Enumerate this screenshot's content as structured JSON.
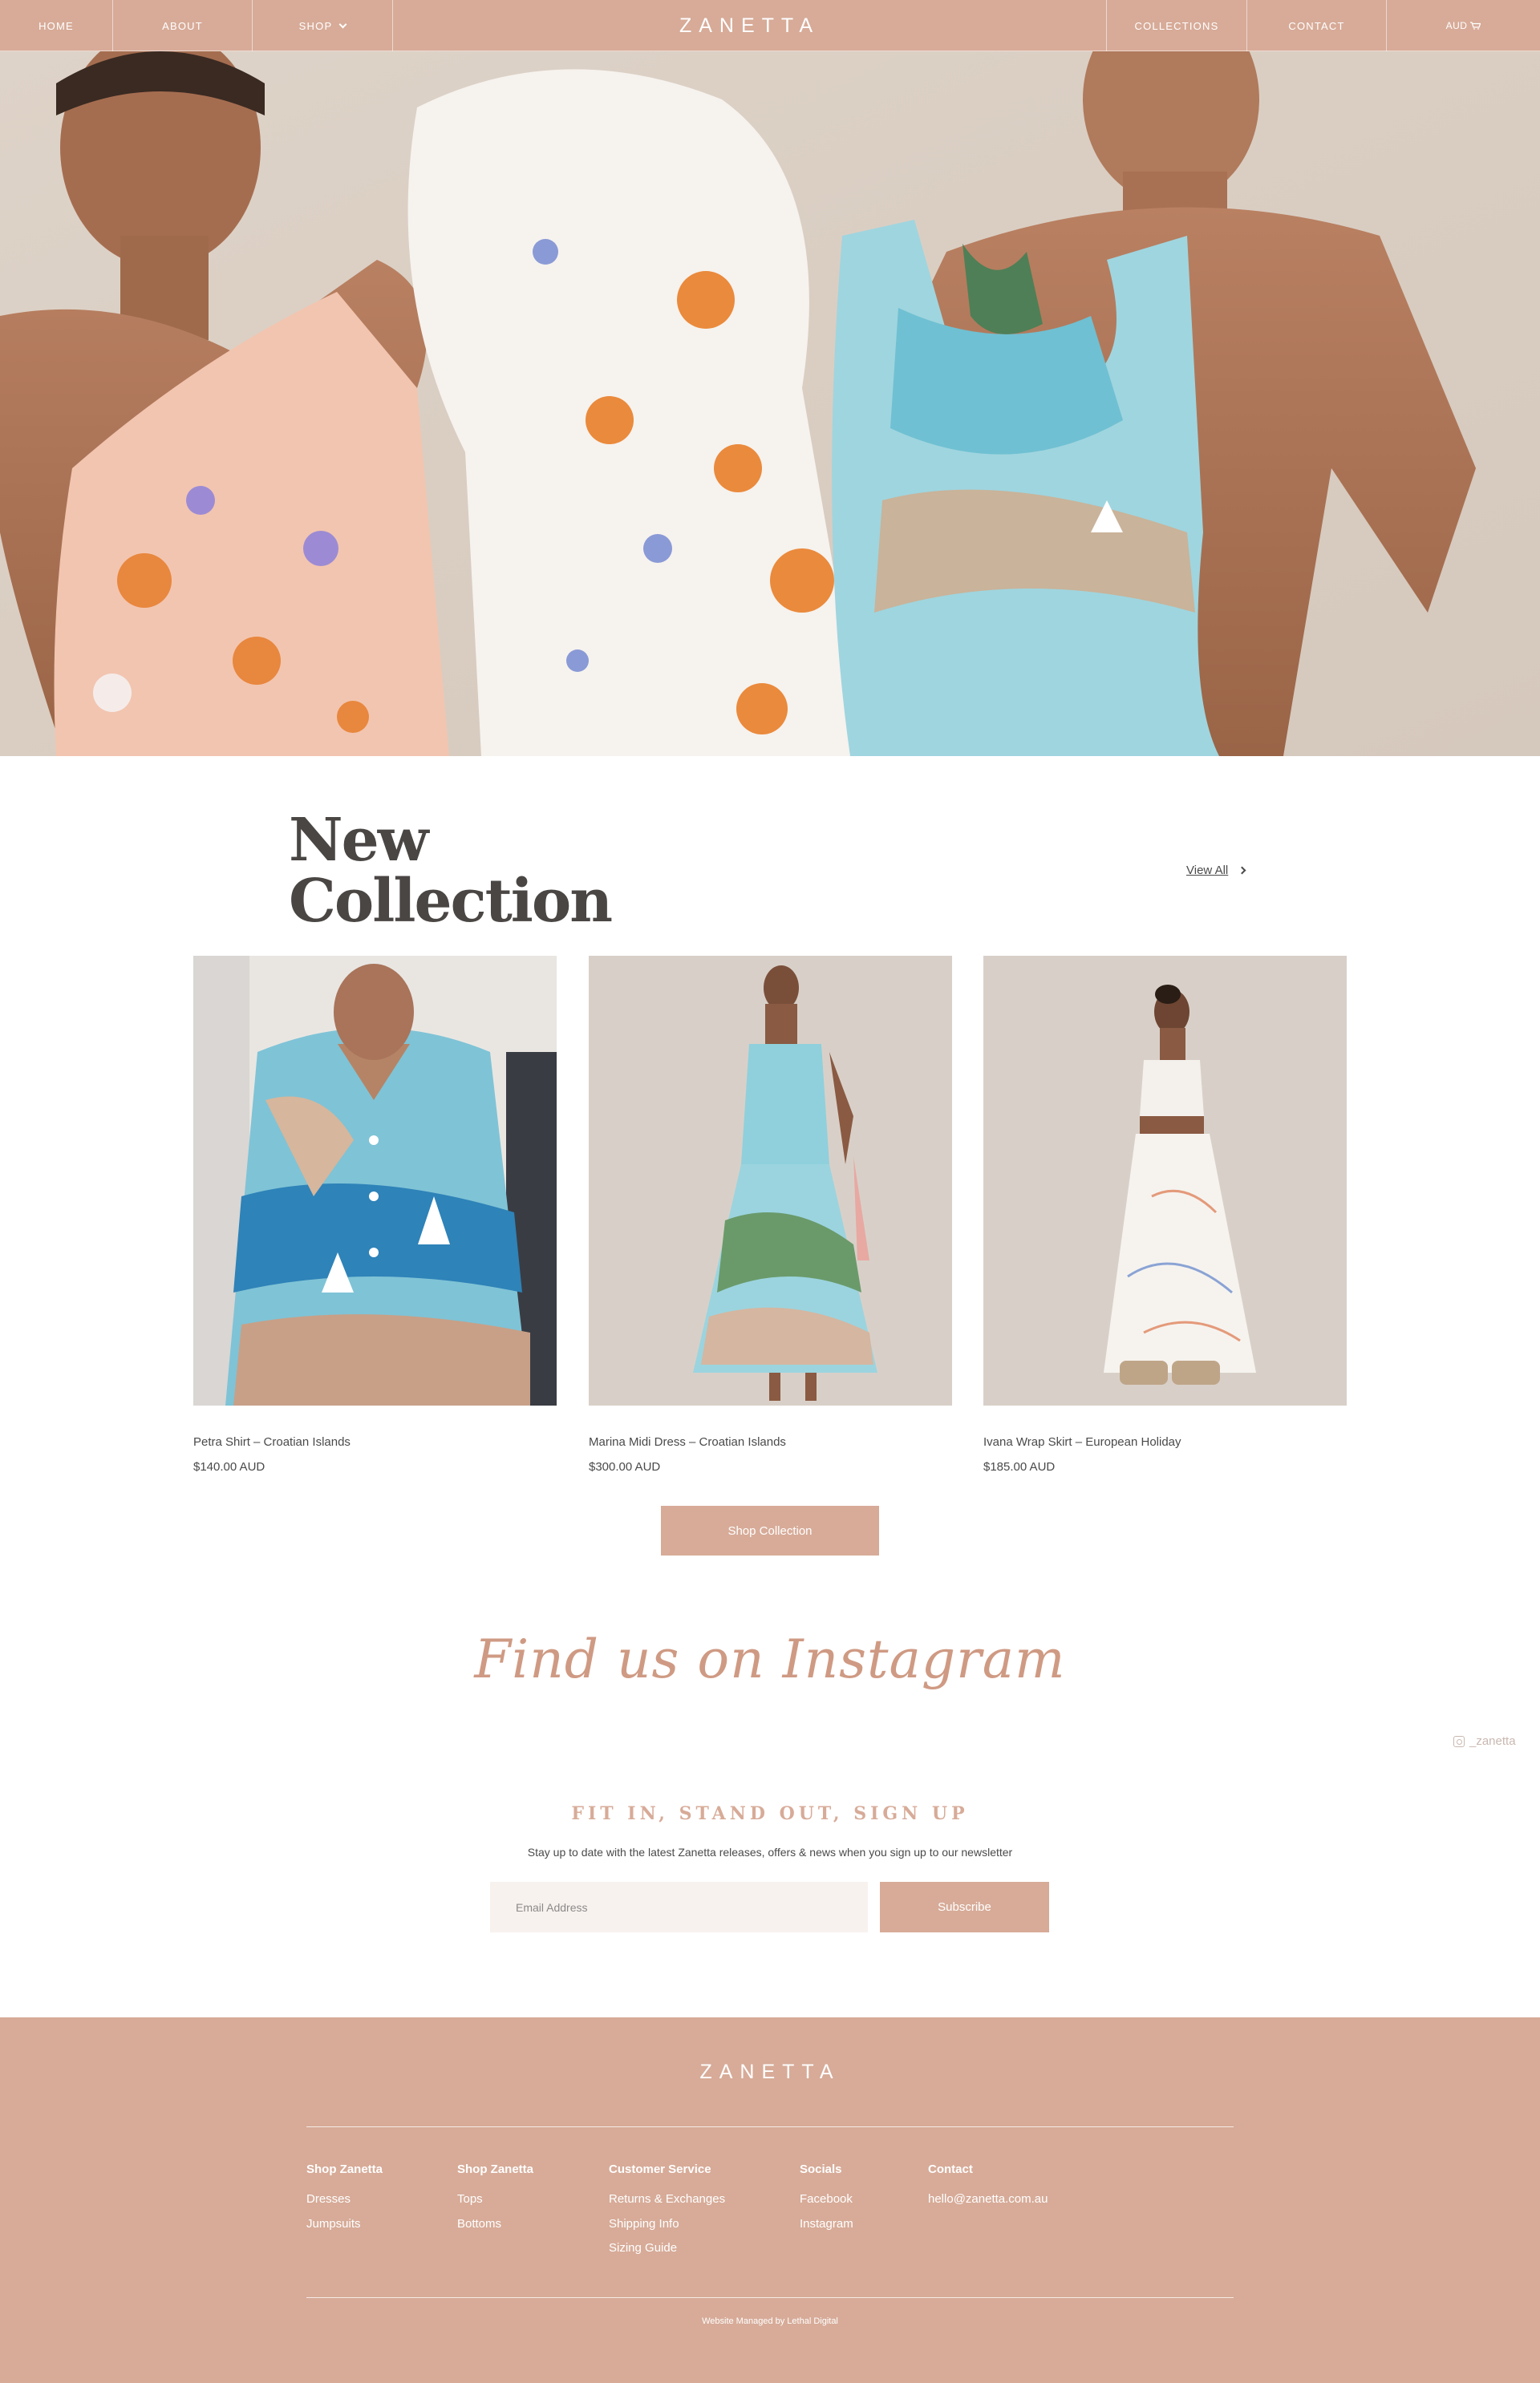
{
  "nav": {
    "home": "HOME",
    "about": "ABOUT",
    "shop": "SHOP",
    "logo": "ZANETTA",
    "collections": "COLLECTIONS",
    "contact": "CONTACT",
    "currency": "AUD"
  },
  "collection": {
    "title_line1": "New",
    "title_line2": "Collection",
    "view_all": "View All",
    "products": [
      {
        "name": "Petra Shirt – Croatian Islands",
        "price": "$140.00 AUD"
      },
      {
        "name": "Marina Midi Dress – Croatian Islands",
        "price": "$300.00 AUD"
      },
      {
        "name": "Ivana Wrap Skirt – European Holiday",
        "price": "$185.00 AUD"
      }
    ],
    "shop_button": "Shop Collection"
  },
  "instagram": {
    "heading": "Find us on Instagram",
    "handle": "_zanetta"
  },
  "signup": {
    "title": "FIT IN, STAND OUT, SIGN UP",
    "subtitle": "Stay up to date with the latest Zanetta releases, offers & news when you sign up to our newsletter",
    "email_placeholder": "Email Address",
    "button": "Subscribe"
  },
  "footer": {
    "logo": "ZANETTA",
    "columns": [
      {
        "heading": "Shop Zanetta",
        "links": [
          "Dresses",
          "Jumpsuits"
        ]
      },
      {
        "heading": "Shop Zanetta",
        "links": [
          "Tops",
          "Bottoms"
        ]
      },
      {
        "heading": "Customer Service",
        "links": [
          "Returns & Exchanges",
          "Shipping Info",
          "Sizing Guide"
        ]
      },
      {
        "heading": "Socials",
        "links": [
          "Facebook",
          "Instagram"
        ]
      },
      {
        "heading": "Contact",
        "links": [
          "hello@zanetta.com.au"
        ]
      }
    ],
    "credit": "Website Managed by Lethal Digital"
  },
  "colors": {
    "brand": "#d7ab98",
    "input_bg": "#f8f2ee",
    "heading_text": "#4a4644"
  }
}
